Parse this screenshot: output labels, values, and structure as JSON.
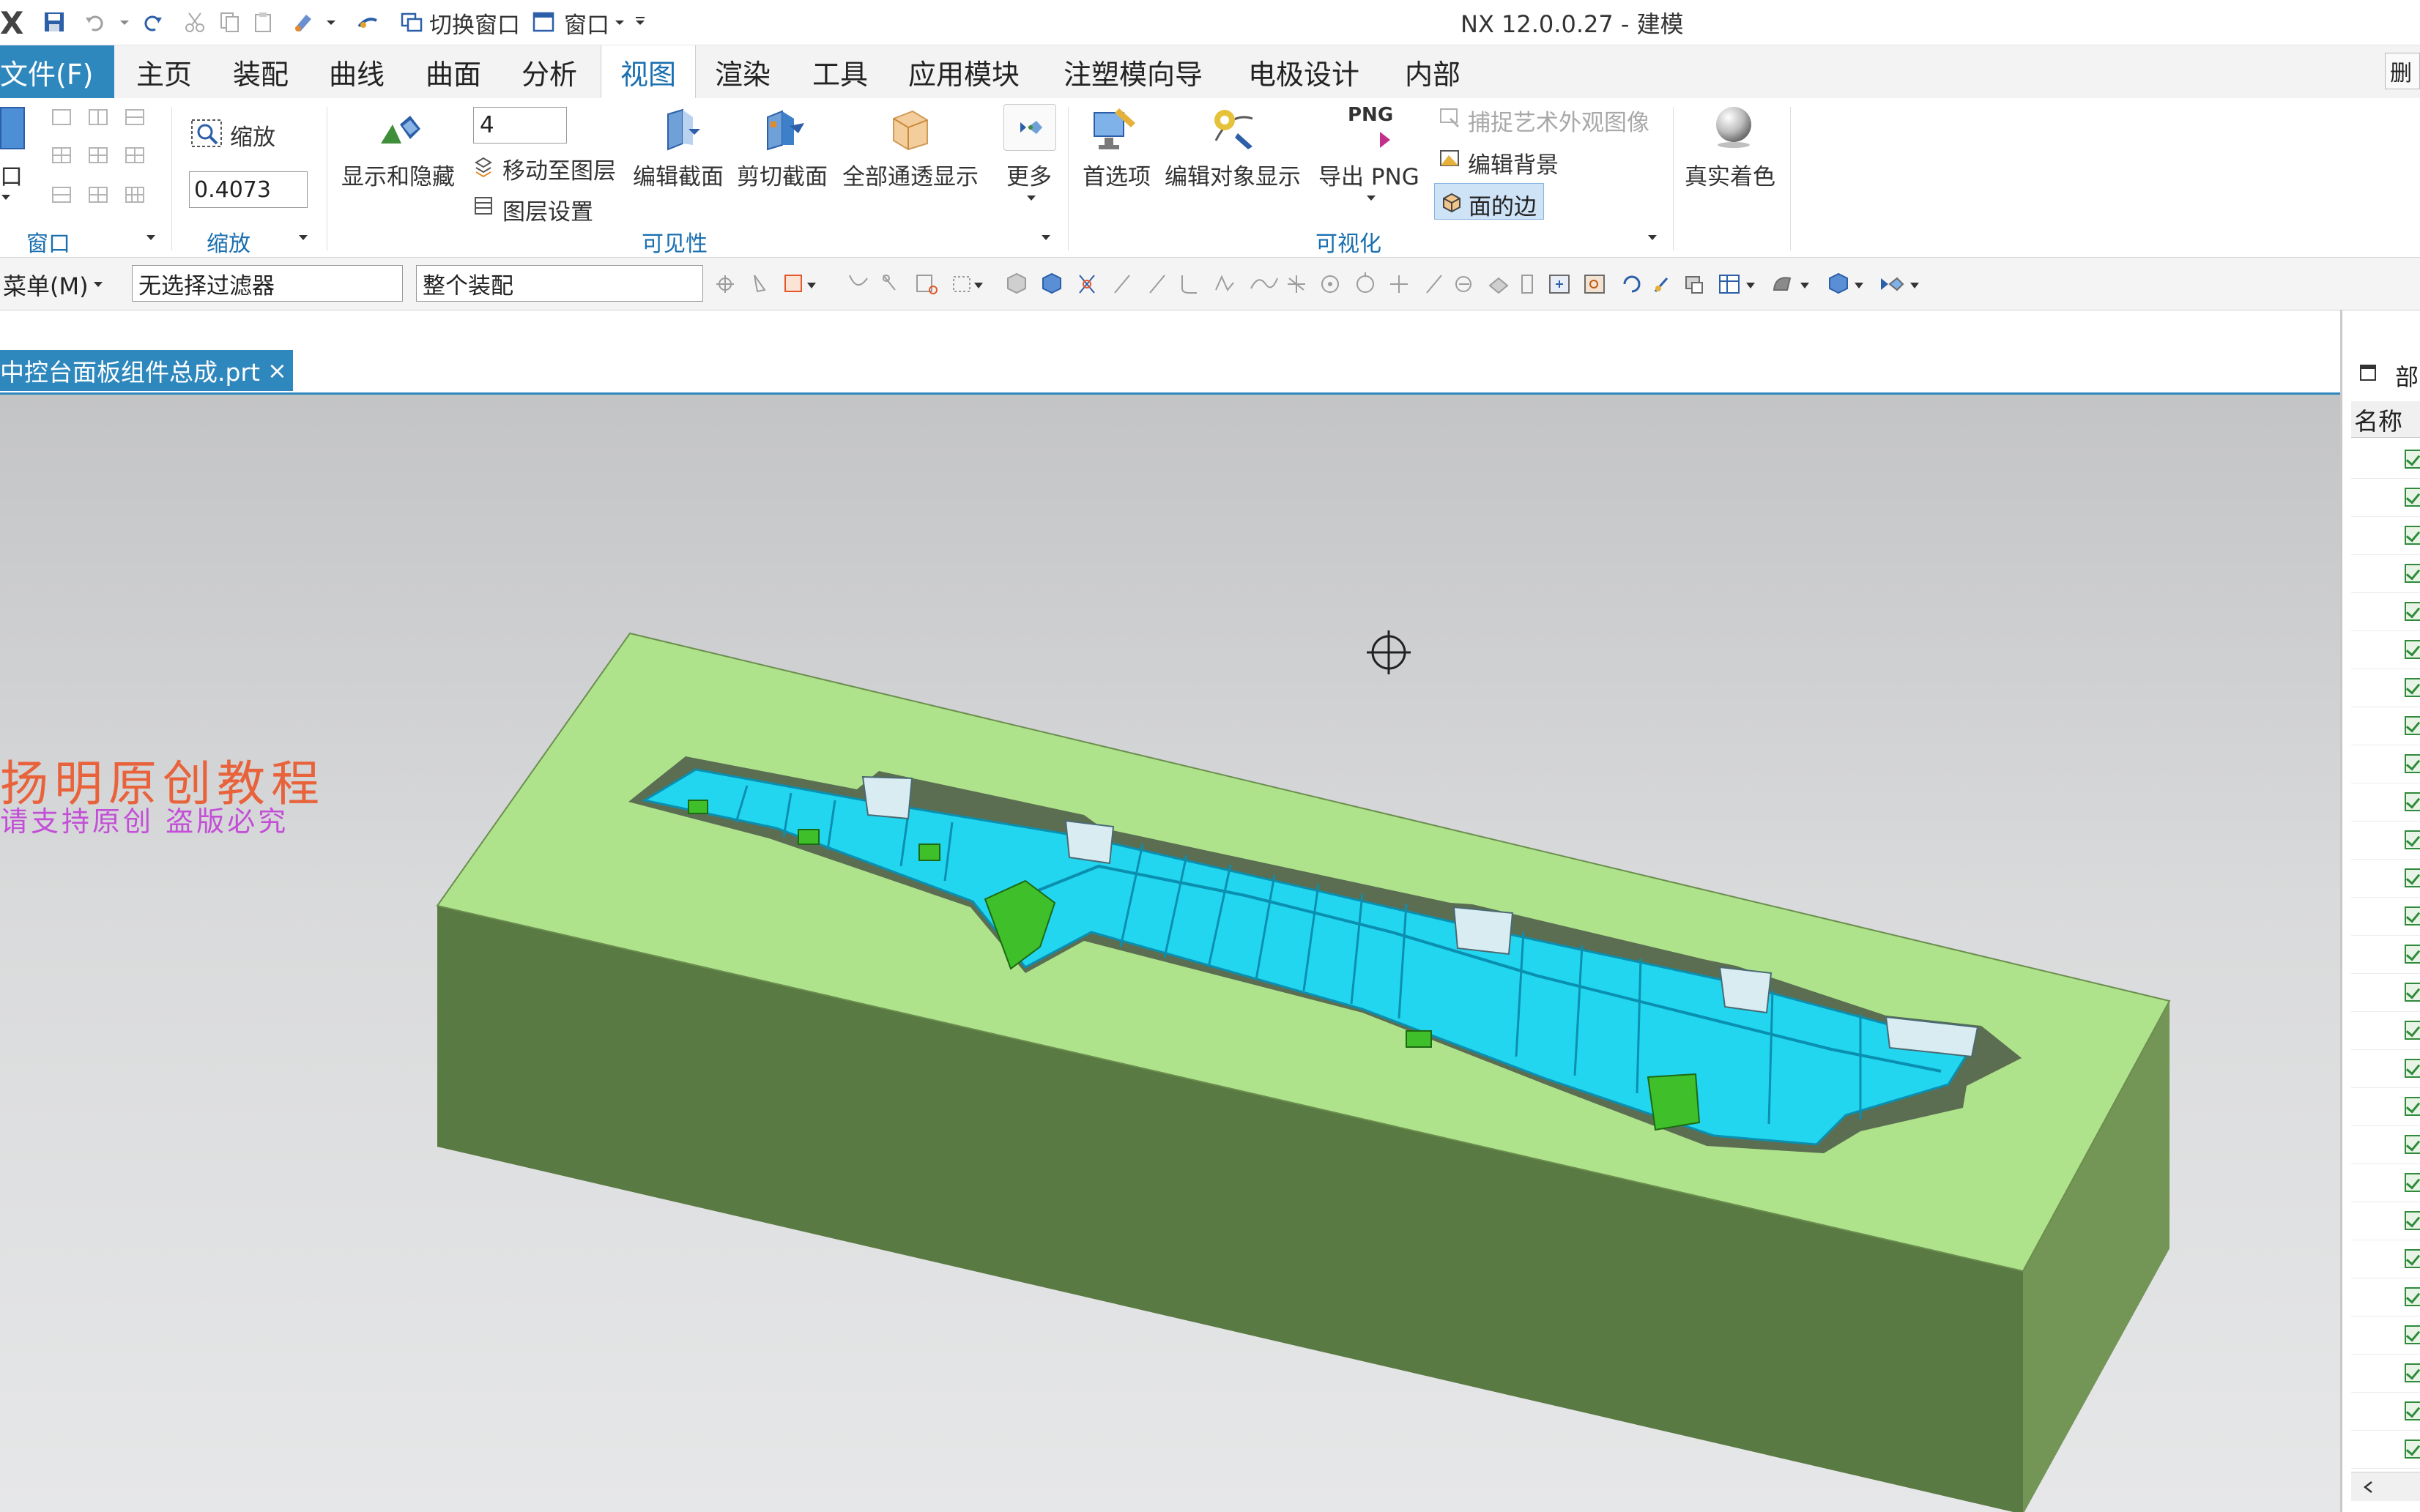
{
  "titlebar": {
    "app_logo": "X",
    "switch_window": "切换窗口",
    "window_menu": "窗口",
    "title": "NX 12.0.0.27 - 建模"
  },
  "menubar": {
    "file": "文件(F)",
    "tabs": [
      "主页",
      "装配",
      "曲线",
      "曲面",
      "分析",
      "视图",
      "渲染",
      "工具",
      "应用模块",
      "注塑模向导",
      "电极设计",
      "内部"
    ],
    "active_tab": "视图",
    "right_button": "删"
  },
  "ribbon": {
    "window_group": {
      "button": "口",
      "label": "窗口"
    },
    "zoom_group": {
      "zoom_button": "缩放",
      "zoom_value": "0.4073",
      "label": "缩放"
    },
    "visibility_group": {
      "show_hide": "显示和隐藏",
      "layer_value": "4",
      "move_to_layer": "移动至图层",
      "layer_settings": "图层设置",
      "edit_section": "编辑截面",
      "clip_section": "剪切截面",
      "see_through_all": "全部通透显示",
      "more": "更多",
      "label": "可见性"
    },
    "visualization_group": {
      "preferences": "首选项",
      "edit_object_display": "编辑对象显示",
      "export_png_top": "PNG",
      "export_png": "导出 PNG",
      "capture_image": "捕捉艺术外观图像",
      "edit_background": "编辑背景",
      "face_edges": "面的边",
      "label": "可视化"
    },
    "true_shading": "真实着色"
  },
  "toolbar": {
    "menu": "菜单(M)",
    "filter": "无选择过滤器",
    "scope": "整个装配"
  },
  "document": {
    "tab": "中控台面板组件总成.prt",
    "close": "×"
  },
  "watermark": {
    "line1": "扬明原创教程",
    "line2": "请支持原创 盗版必究"
  },
  "part_navigator": {
    "title": "部",
    "column": "名称",
    "row_count": 27
  },
  "colors": {
    "accent": "#2f88bd",
    "block_top": "#aee38c",
    "block_front": "#5e7e46",
    "block_side": "#739556",
    "cavity_part": "#22d6f0",
    "part_green": "#3fbf2a",
    "watermark_red": "#e8633c",
    "watermark_purple": "#c24fd6"
  }
}
